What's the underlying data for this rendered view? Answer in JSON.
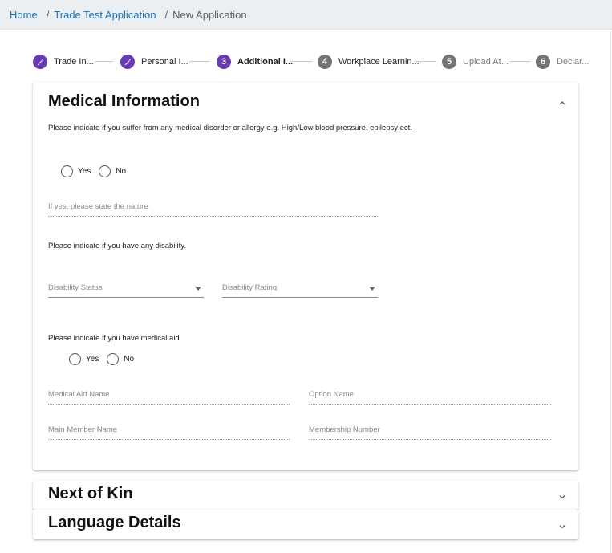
{
  "breadcrumb": {
    "home": "Home",
    "sep1": "/",
    "trade_test": "Trade Test Application",
    "sep2": "/",
    "current": "New Application"
  },
  "stepper": {
    "steps": [
      {
        "number": "1",
        "label": "Trade In...",
        "state": "completed"
      },
      {
        "number": "2",
        "label": "Personal I...",
        "state": "completed"
      },
      {
        "number": "3",
        "label": "Additional I...",
        "state": "active"
      },
      {
        "number": "4",
        "label": "Workplace Learnin...",
        "state": "pending"
      },
      {
        "number": "5",
        "label": "Upload At...",
        "state": "pending"
      },
      {
        "number": "6",
        "label": "Declar...",
        "state": "pending"
      }
    ]
  },
  "colors": {
    "accent": "#673ab7",
    "link": "#1976d2",
    "pending_step": "#757575"
  },
  "medical": {
    "title": "Medical Information",
    "disorder_question": "Please indicate if you suffer from any medical disorder or allergy e.g. High/Low blood pressure, epilepsy ect.",
    "disorder_yes": "Yes",
    "disorder_no": "No",
    "nature_placeholder": "If yes, please state the nature",
    "disability_question": "Please indicate if you have any disability.",
    "disability_status": "Disability Status",
    "disability_rating": "Disability Rating",
    "aid_question": "Please indicate if you have medical aid",
    "aid_yes": "Yes",
    "aid_no": "No",
    "aid_name": "Medical Aid Name",
    "option_name": "Option Name",
    "main_member": "Main Member Name",
    "membership_number": "Membership Number"
  },
  "next_of_kin": {
    "title": "Next of Kin"
  },
  "language": {
    "title": "Language Details"
  },
  "icons": {
    "completed_step": "pencil-icon",
    "expanded": "chevron-up-icon",
    "collapsed": "chevron-down-icon"
  }
}
